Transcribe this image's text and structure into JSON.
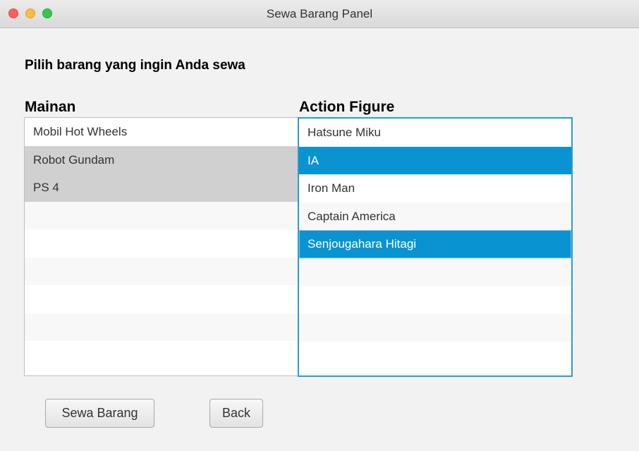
{
  "window": {
    "title": "Sewa Barang Panel"
  },
  "prompt": "Pilih barang yang ingin Anda sewa",
  "mainan": {
    "label": "Mainan",
    "items": [
      "Mobil Hot Wheels",
      "Robot Gundam",
      "PS 4"
    ],
    "selected": [
      "Robot Gundam",
      "PS 4"
    ]
  },
  "action_figure": {
    "label": "Action Figure",
    "items": [
      "Hatsune Miku",
      "IA",
      "Iron Man",
      "Captain America",
      "Senjougahara Hitagi"
    ],
    "selected": [
      "IA",
      "Senjougahara Hitagi"
    ]
  },
  "buttons": {
    "sewa": "Sewa Barang",
    "back": "Back"
  },
  "colors": {
    "selection_blue": "#0a93d1",
    "selection_gray": "#d0d0d0",
    "focus_border": "#2b9bd4"
  }
}
